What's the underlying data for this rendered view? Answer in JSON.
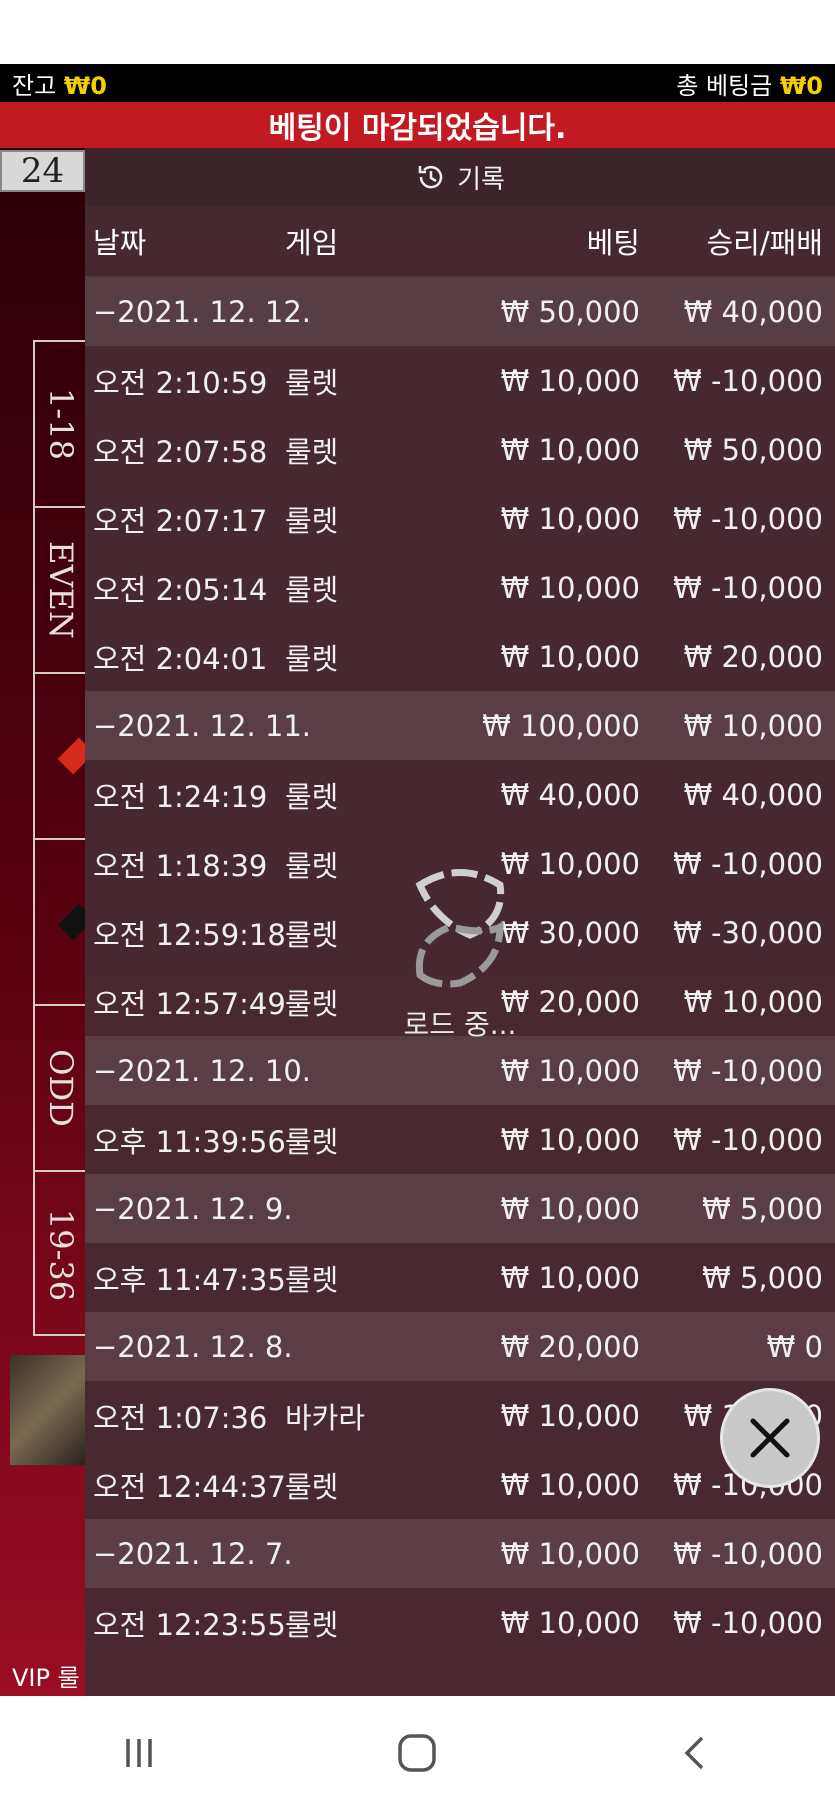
{
  "topbar": {
    "balance_label": "잔고",
    "balance_value": "₩0",
    "total_bet_label": "총 베팅금",
    "total_bet_value": "₩0"
  },
  "banner": {
    "text": "베팅이 마감되었습니다."
  },
  "last_number": "24",
  "side_board": [
    "1-18",
    "EVEN",
    "",
    "",
    "ODD",
    "19-36"
  ],
  "vip_label": "VIP 룰",
  "history": {
    "title": "기록",
    "columns": {
      "date": "날짜",
      "game": "게임",
      "bet": "베팅",
      "result": "승리/패배"
    },
    "rows": [
      {
        "type": "date",
        "label": "−2021. 12. 12.",
        "bet": "₩ 50,000",
        "result": "₩ 40,000"
      },
      {
        "type": "item",
        "time": "오전 2:10:59",
        "game": "룰렛",
        "bet": "₩ 10,000",
        "result": "₩ -10,000"
      },
      {
        "type": "item",
        "time": "오전 2:07:58",
        "game": "룰렛",
        "bet": "₩ 10,000",
        "result": "₩ 50,000"
      },
      {
        "type": "item",
        "time": "오전 2:07:17",
        "game": "룰렛",
        "bet": "₩ 10,000",
        "result": "₩ -10,000"
      },
      {
        "type": "item",
        "time": "오전 2:05:14",
        "game": "룰렛",
        "bet": "₩ 10,000",
        "result": "₩ -10,000"
      },
      {
        "type": "item",
        "time": "오전 2:04:01",
        "game": "룰렛",
        "bet": "₩ 10,000",
        "result": "₩ 20,000"
      },
      {
        "type": "date",
        "label": "−2021. 12. 11.",
        "bet": "₩ 100,000",
        "result": "₩ 10,000"
      },
      {
        "type": "item",
        "time": "오전 1:24:19",
        "game": "룰렛",
        "bet": "₩ 40,000",
        "result": "₩ 40,000"
      },
      {
        "type": "item",
        "time": "오전 1:18:39",
        "game": "룰렛",
        "bet": "₩ 10,000",
        "result": "₩ -10,000"
      },
      {
        "type": "item",
        "time": "오전 12:59:18",
        "game": "룰렛",
        "bet": "₩ 30,000",
        "result": "₩ -30,000"
      },
      {
        "type": "item",
        "time": "오전 12:57:49",
        "game": "룰렛",
        "bet": "₩ 20,000",
        "result": "₩ 10,000"
      },
      {
        "type": "date",
        "label": "−2021. 12. 10.",
        "bet": "₩ 10,000",
        "result": "₩ -10,000"
      },
      {
        "type": "item",
        "time": "오후 11:39:56",
        "game": "룰렛",
        "bet": "₩ 10,000",
        "result": "₩ -10,000"
      },
      {
        "type": "date",
        "label": "−2021. 12. 9.",
        "bet": "₩ 10,000",
        "result": "₩ 5,000"
      },
      {
        "type": "item",
        "time": "오후 11:47:35",
        "game": "룰렛",
        "bet": "₩ 10,000",
        "result": "₩ 5,000"
      },
      {
        "type": "date",
        "label": "−2021. 12. 8.",
        "bet": "₩ 20,000",
        "result": "₩ 0"
      },
      {
        "type": "item",
        "time": "오전 1:07:36",
        "game": "바카라",
        "bet": "₩ 10,000",
        "result": "₩ 10,000"
      },
      {
        "type": "item",
        "time": "오전 12:44:37",
        "game": "룰렛",
        "bet": "₩ 10,000",
        "result": "₩ -10,000"
      },
      {
        "type": "date",
        "label": "−2021. 12. 7.",
        "bet": "₩ 10,000",
        "result": "₩ -10,000"
      },
      {
        "type": "item",
        "time": "오전 12:23:55",
        "game": "룰렛",
        "bet": "₩ 10,000",
        "result": "₩ -10,000"
      }
    ]
  },
  "loading": {
    "text": "로드 중..."
  },
  "icons": {
    "history": "history-icon",
    "close": "close-icon",
    "loader": "spinner-icon"
  },
  "colors": {
    "banner": "#c21a22",
    "amount": "#f5d000",
    "panel": "#482a32"
  }
}
